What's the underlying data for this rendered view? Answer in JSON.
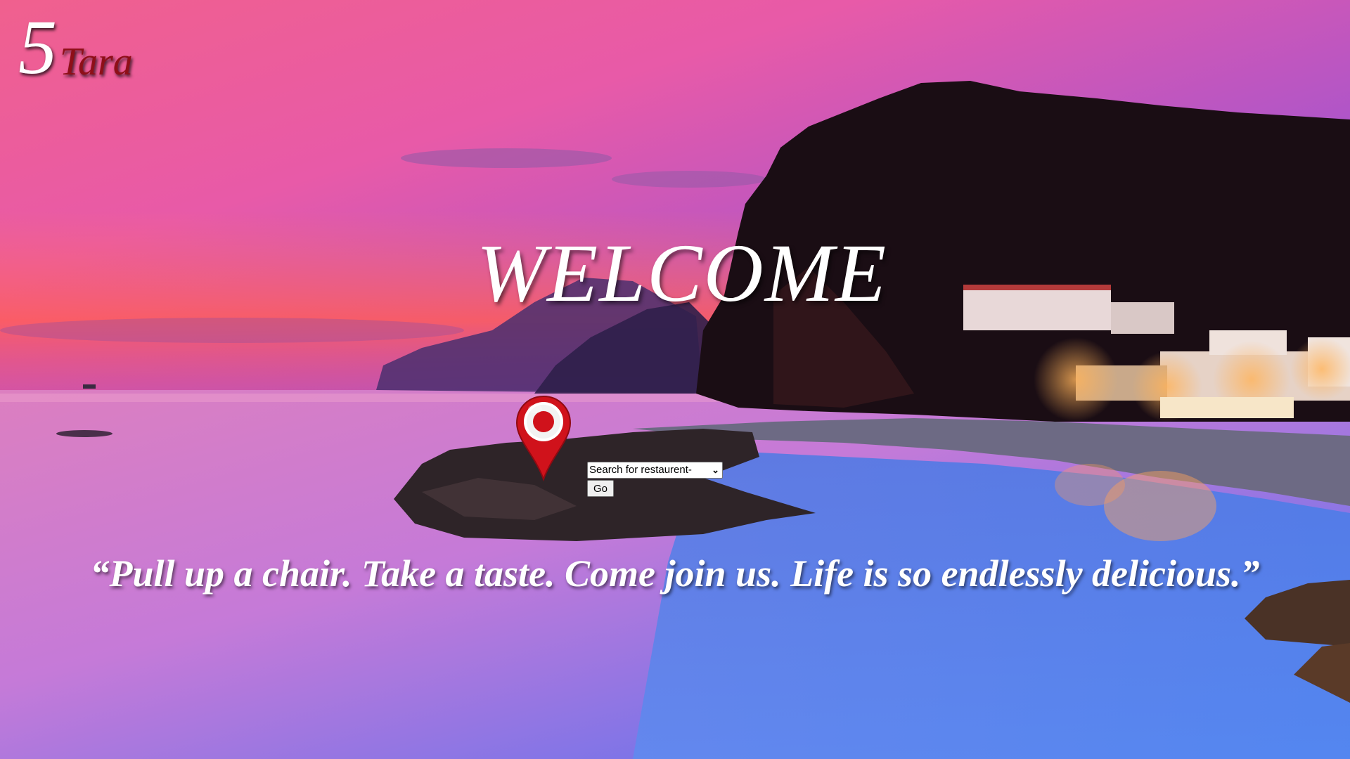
{
  "logo": {
    "number": "5",
    "name": "Tara"
  },
  "hero": {
    "heading": "WELCOME",
    "quote": "“Pull up a chair. Take a taste. Come join us. Life is so endlessly delicious.”"
  },
  "search": {
    "select_value": "Search for restaurent-",
    "go_label": "Go"
  },
  "icons": {
    "pin": "location-pin-icon",
    "dropdown": "chevron-down-icon"
  },
  "colors": {
    "brand_red": "#8f0f18",
    "pin_red": "#d0121b"
  }
}
